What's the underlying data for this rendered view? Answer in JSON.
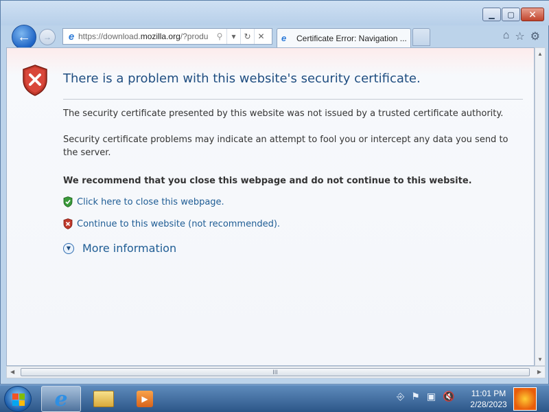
{
  "window": {
    "caption_buttons": {
      "minimize": "▁",
      "maximize": "▢",
      "close": "✕"
    }
  },
  "nav": {
    "back_icon": "←",
    "forward_icon": "→",
    "address": {
      "prefix": "https://download.",
      "domain": "mozilla.org",
      "suffix": "/?produ"
    },
    "search_icon": "⚲",
    "dropdown_icon": "▾",
    "refresh_icon": "↻",
    "stop_icon": "✕",
    "tab_title": "Certificate Error: Navigation ...",
    "right_icons": {
      "home": "⌂",
      "favorites": "☆",
      "tools": "⚙"
    }
  },
  "page": {
    "heading": "There is a problem with this website's security certificate.",
    "para1": "The security certificate presented by this website was not issued by a trusted certificate authority.",
    "para2": "Security certificate problems may indicate an attempt to fool you or intercept any data you send to the server.",
    "recommend": "We recommend that you close this webpage and do not continue to this website.",
    "close_link": "Click here to close this webpage.",
    "continue_link": "Continue to this website (not recommended).",
    "more_info": "More information",
    "more_info_icon": "▼"
  },
  "scroll": {
    "up": "▲",
    "down": "▼",
    "left": "◀",
    "right": "▶",
    "grip": "III"
  },
  "taskbar": {
    "clock_time": "11:01 PM",
    "clock_date": "2/28/2023",
    "media_icon": "▶",
    "tray": {
      "network": "⎆",
      "flag": "⚑",
      "display": "▣",
      "volume": "🔇"
    }
  },
  "colors": {
    "heading": "#1f4d80",
    "link": "#1e5c94",
    "shield_red": "#c0392b",
    "shield_green": "#3a9a3a"
  }
}
